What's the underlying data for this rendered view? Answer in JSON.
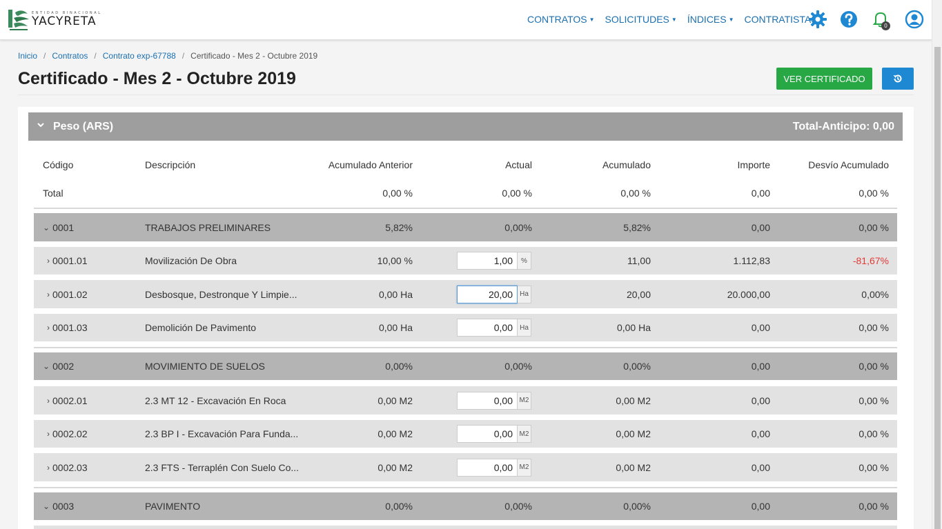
{
  "brand": {
    "small": "ENTIDAD BINACIONAL",
    "big": "YACYRETA"
  },
  "nav": [
    {
      "label": "CONTRATOS"
    },
    {
      "label": "SOLICITUDES"
    },
    {
      "label": "ÍNDICES"
    },
    {
      "label": "CONTRATISTAS"
    }
  ],
  "notifications": {
    "count": "0"
  },
  "breadcrumb": {
    "home": "Inicio",
    "contracts": "Contratos",
    "contract": "Contrato exp-67788",
    "current": "Certificado - Mes 2 - Octubre 2019"
  },
  "page": {
    "title": "Certificado - Mes 2 - Octubre 2019",
    "ver_button": "VER CERTIFICADO"
  },
  "card": {
    "title": "Peso (ARS)",
    "total": "Total-Anticipo: 0,00"
  },
  "table": {
    "headers": {
      "code": "Código",
      "desc": "Descripción",
      "ant": "Acumulado Anterior",
      "act": "Actual",
      "acu": "Acumulado",
      "imp": "Importe",
      "des": "Desvío Acumulado"
    },
    "total": {
      "label": "Total",
      "ant": "0,00 %",
      "act": "0,00 %",
      "acu": "0,00 %",
      "imp": "0,00",
      "des": "0,00 %"
    },
    "rows": [
      {
        "code": "0001",
        "desc": "TRABAJOS PRELIMINARES",
        "ant": "5,82%",
        "act": "0,00%",
        "acu": "5,82%",
        "imp": "0,00",
        "des": "0,00 %"
      },
      {
        "code": "0001.01",
        "desc": "Movilización De Obra",
        "ant": "10,00 %",
        "act": "1,00",
        "unit": "%",
        "acu": "11,00",
        "imp": "1.112,83",
        "des": "-81,67%"
      },
      {
        "code": "0001.02",
        "desc": "Desbosque, Destronque Y Limpie...",
        "ant": "0,00 Ha",
        "act": "20,00",
        "unit": "Ha",
        "acu": "20,00",
        "imp": "20.000,00",
        "des": "0,00%"
      },
      {
        "code": "0001.03",
        "desc": "Demolición De Pavimento",
        "ant": "0,00 Ha",
        "act": "0,00",
        "unit": "Ha",
        "acu": "0,00 Ha",
        "imp": "0,00",
        "des": "0,00 %"
      },
      {
        "code": "0002",
        "desc": "MOVIMIENTO DE SUELOS",
        "ant": "0,00%",
        "act": "0,00%",
        "acu": "0,00%",
        "imp": "0,00",
        "des": "0,00 %"
      },
      {
        "code": "0002.01",
        "desc": "2.3 MT 12 - Excavación En Roca",
        "ant": "0,00 M2",
        "act": "0,00",
        "unit": "M2",
        "acu": "0,00 M2",
        "imp": "0,00",
        "des": "0,00 %"
      },
      {
        "code": "0002.02",
        "desc": "2.3 BP I - Excavación Para Funda...",
        "ant": "0,00 M2",
        "act": "0,00",
        "unit": "M2",
        "acu": "0,00 M2",
        "imp": "0,00",
        "des": "0,00 %"
      },
      {
        "code": "0002.03",
        "desc": "2.3 FTS - Terraplén Con Suelo Co...",
        "ant": "0,00 M2",
        "act": "0,00",
        "unit": "M2",
        "acu": "0,00 M2",
        "imp": "0,00",
        "des": "0,00 %"
      },
      {
        "code": "0003",
        "desc": "PAVIMENTO",
        "ant": "0,00%",
        "act": "0,00%",
        "acu": "0,00%",
        "imp": "0,00",
        "des": "0,00 %"
      }
    ]
  },
  "colors": {
    "link": "#1a6fb0",
    "green": "#28a745",
    "blue": "#1e88d2",
    "negative": "#e53935"
  }
}
